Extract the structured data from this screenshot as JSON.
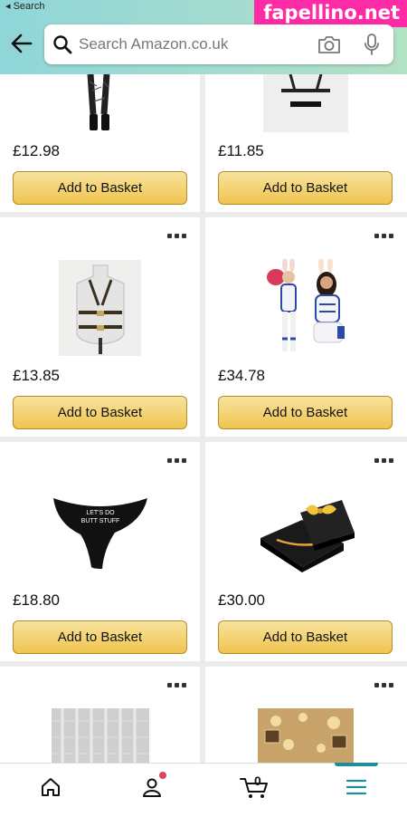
{
  "status": {
    "back_label": "◂ Search"
  },
  "watermark": "fapellino.net",
  "search": {
    "placeholder": "Search Amazon.co.uk"
  },
  "products": [
    {
      "price": "£12.98",
      "button": "Add to Basket"
    },
    {
      "price": "£11.85",
      "button": "Add to Basket"
    },
    {
      "price": "£13.85",
      "button": "Add to Basket"
    },
    {
      "price": "£34.78",
      "button": "Add to Basket"
    },
    {
      "price": "£18.80",
      "button": "Add to Basket",
      "image_text": "LET'S DO BUTT STUFF"
    },
    {
      "price": "£30.00",
      "button": "Add to Basket"
    }
  ],
  "nav": {
    "cart_count": "0",
    "items": [
      "home-icon",
      "account-icon",
      "cart-icon",
      "menu-icon"
    ],
    "active": "menu-icon",
    "accent": "#1b8f98"
  },
  "colors": {
    "button_top": "#f8e29d",
    "button_bottom": "#efc54f",
    "notification": "#e0435e"
  }
}
